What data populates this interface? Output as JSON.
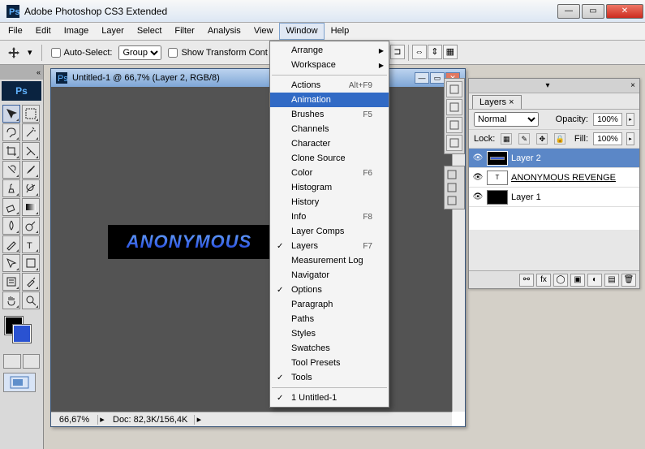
{
  "titlebar": {
    "app_icon_name": "ps-icon",
    "title": "Adobe Photoshop CS3 Extended"
  },
  "menubar": [
    "File",
    "Edit",
    "Image",
    "Layer",
    "Select",
    "Filter",
    "Analysis",
    "View",
    "Window",
    "Help"
  ],
  "active_menu_index": 8,
  "options_bar": {
    "auto_select_label": "Auto-Select:",
    "auto_select_options": [
      "Group"
    ],
    "show_transform_label": "Show Transform Cont"
  },
  "document": {
    "title": "Untitled-1 @ 66,7% (Layer 2, RGB/8)",
    "zoom": "66,67%",
    "doc_info": "Doc: 82,3K/156,4K",
    "canvas_text": "ANONYMOUS"
  },
  "dropdown": {
    "groups": [
      [
        {
          "label": "Arrange",
          "submenu": true
        },
        {
          "label": "Workspace",
          "submenu": true
        }
      ],
      [
        {
          "label": "Actions",
          "shortcut": "Alt+F9"
        },
        {
          "label": "Animation",
          "highlight": true
        },
        {
          "label": "Brushes",
          "shortcut": "F5"
        },
        {
          "label": "Channels"
        },
        {
          "label": "Character"
        },
        {
          "label": "Clone Source"
        },
        {
          "label": "Color",
          "shortcut": "F6"
        },
        {
          "label": "Histogram"
        },
        {
          "label": "History"
        },
        {
          "label": "Info",
          "shortcut": "F8"
        },
        {
          "label": "Layer Comps"
        },
        {
          "label": "Layers",
          "shortcut": "F7",
          "checked": true
        },
        {
          "label": "Measurement Log"
        },
        {
          "label": "Navigator"
        },
        {
          "label": "Options",
          "checked": true
        },
        {
          "label": "Paragraph"
        },
        {
          "label": "Paths"
        },
        {
          "label": "Styles"
        },
        {
          "label": "Swatches"
        },
        {
          "label": "Tool Presets"
        },
        {
          "label": "Tools",
          "checked": true
        }
      ],
      [
        {
          "label": "1 Untitled-1",
          "checked": true
        }
      ]
    ]
  },
  "layers_panel": {
    "tab_label": "Layers ×",
    "blend_mode": "Normal",
    "opacity_label": "Opacity:",
    "opacity_value": "100%",
    "lock_label": "Lock:",
    "fill_label": "Fill:",
    "fill_value": "100%",
    "layers": [
      {
        "name": "Layer 2",
        "selected": true,
        "visible": true,
        "thumb": "canvas"
      },
      {
        "name": "ANONYMOUS REVENGE",
        "visible": true,
        "thumb": "text",
        "underline": true
      },
      {
        "name": "Layer 1",
        "visible": true,
        "thumb": "black"
      }
    ]
  },
  "dock_a_icons": [
    "navigator-icon",
    "histogram-icon",
    "info-icon",
    "color-icon"
  ],
  "dock_b_icons": [
    "character-icon",
    "paragraph-icon",
    "layercomps-icon"
  ],
  "tools": [
    "move",
    "marquee",
    "lasso",
    "wand",
    "crop",
    "slice",
    "healing",
    "brush",
    "stamp",
    "history-brush",
    "eraser",
    "gradient",
    "blur",
    "dodge",
    "pen",
    "type",
    "path-sel",
    "shape",
    "notes",
    "eyedropper",
    "hand",
    "zoom"
  ]
}
